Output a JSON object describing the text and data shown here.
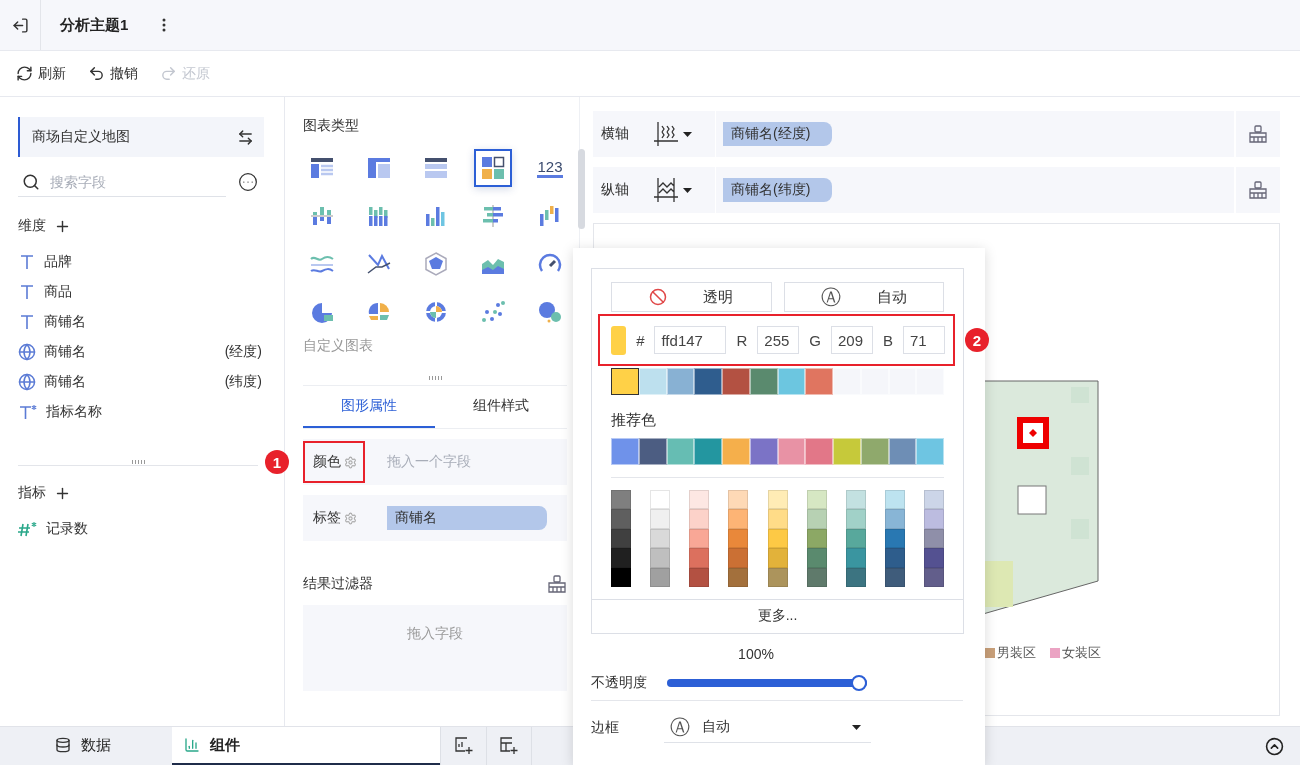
{
  "header": {
    "title": "分析主题1"
  },
  "toolbar": [
    {
      "kind": "refresh",
      "label": "刷新",
      "disabled": false
    },
    {
      "kind": "undo",
      "label": "撤销",
      "disabled": false
    },
    {
      "kind": "redo",
      "label": "还原",
      "disabled": true
    }
  ],
  "dataset": {
    "name": "商场自定义地图"
  },
  "search": {
    "placeholder": "搜索字段"
  },
  "dimensions": {
    "title": "维度",
    "fields": [
      {
        "kind": "text",
        "name": "品牌"
      },
      {
        "kind": "text",
        "name": "商品"
      },
      {
        "kind": "text",
        "name": "商铺名"
      },
      {
        "kind": "geo",
        "name": "商铺名",
        "suffix": "(经度)"
      },
      {
        "kind": "geo",
        "name": "商铺名",
        "suffix": "(纬度)"
      },
      {
        "kind": "calc-text",
        "name": "指标名称"
      }
    ]
  },
  "measures": {
    "title": "指标",
    "fields": [
      {
        "kind": "calc-number",
        "name": "记录数"
      }
    ]
  },
  "chart_types": {
    "title": "图表类型",
    "custom_label": "自定义图表",
    "items": [
      {
        "kind": "table",
        "selected": false
      },
      {
        "kind": "crosstab",
        "selected": false
      },
      {
        "kind": "detail",
        "selected": false
      },
      {
        "kind": "dashboard",
        "selected": true
      },
      {
        "kind": "kpi",
        "label": "123",
        "selected": false
      },
      {
        "kind": "bar-dot",
        "selected": false
      },
      {
        "kind": "bar-stack",
        "selected": false
      },
      {
        "kind": "bar",
        "selected": false
      },
      {
        "kind": "bar-horizontal",
        "selected": false
      },
      {
        "kind": "waterfall",
        "selected": false
      },
      {
        "kind": "line-wave",
        "selected": false
      },
      {
        "kind": "line",
        "selected": false
      },
      {
        "kind": "radar",
        "selected": false
      },
      {
        "kind": "area",
        "selected": false
      },
      {
        "kind": "gauge",
        "selected": false
      },
      {
        "kind": "pie",
        "selected": false
      },
      {
        "kind": "pie-split",
        "selected": false
      },
      {
        "kind": "sunburst",
        "selected": false
      },
      {
        "kind": "scatter",
        "selected": false
      },
      {
        "kind": "bubble",
        "selected": false
      }
    ]
  },
  "property_tabs": [
    {
      "label": "图形属性",
      "selected": true
    },
    {
      "label": "组件样式",
      "selected": false
    }
  ],
  "properties": [
    {
      "label": "颜色",
      "placeholder": "拖入一个字段",
      "highlighted": true,
      "badge": "1"
    },
    {
      "label": "标签",
      "chip": "商铺名",
      "highlighted": false
    }
  ],
  "result_filter": {
    "title": "结果过滤器",
    "placeholder": "拖入字段"
  },
  "axes": [
    {
      "kind": "x",
      "label": "横轴",
      "chip": "商铺名(经度)"
    },
    {
      "kind": "y",
      "label": "纵轴",
      "chip": "商铺名(纬度)"
    }
  ],
  "chart": {
    "legend": [
      {
        "label": "男装区",
        "color": "#c9a07a"
      },
      {
        "label": "女装区",
        "color": "#eba3c3"
      }
    ]
  },
  "color_picker": {
    "transparent_label": "透明",
    "auto_icon": "Ⓐ",
    "auto_label": "自动",
    "current": {
      "color": "#ffd147"
    },
    "hash": "#",
    "hex": "ffd147",
    "r_label": "R",
    "r": "255",
    "g_label": "G",
    "g": "209",
    "b_label": "B",
    "b": "71",
    "highlighted": true,
    "badge": "2",
    "recent": [
      {
        "color": "#ffd147",
        "selected": true
      },
      {
        "color": "#bde0ee",
        "selected": false
      },
      {
        "color": "#88b1d3",
        "selected": false
      },
      {
        "color": "#2f5d8e",
        "selected": false
      },
      {
        "color": "#b35142",
        "selected": false
      },
      {
        "color": "#5a8a6e",
        "selected": false
      },
      {
        "color": "#6cc6e0",
        "selected": false
      },
      {
        "color": "#e07560",
        "selected": false
      },
      {
        "color": "#f5f6fa",
        "selected": false
      },
      {
        "color": "#f5f6fa",
        "selected": false
      },
      {
        "color": "#f5f6fa",
        "selected": false
      },
      {
        "color": "#f5f6fa",
        "selected": false
      }
    ],
    "recommended_label": "推荐色",
    "recommended": [
      {
        "color": "#6f92ea"
      },
      {
        "color": "#4c5d82"
      },
      {
        "color": "#66bdb3"
      },
      {
        "color": "#2396a0"
      },
      {
        "color": "#f5af4b"
      },
      {
        "color": "#7b73c6"
      },
      {
        "color": "#e892a5"
      },
      {
        "color": "#e27788"
      },
      {
        "color": "#c6c93a"
      },
      {
        "color": "#8fa96c"
      },
      {
        "color": "#6e8eb5"
      },
      {
        "color": "#6ec5e2"
      }
    ],
    "shades": [
      {
        "colors": [
          {
            "color": "#7f7f7f"
          },
          {
            "color": "#5f5f5f"
          },
          {
            "color": "#404040"
          },
          {
            "color": "#202020"
          },
          {
            "color": "#000000"
          }
        ]
      },
      {
        "colors": [
          {
            "color": "#ffffff"
          },
          {
            "color": "#f0f0f0"
          },
          {
            "color": "#d9d9d9"
          },
          {
            "color": "#bfbfbf"
          },
          {
            "color": "#a0a0a0"
          }
        ]
      },
      {
        "colors": [
          {
            "color": "#fde7e3"
          },
          {
            "color": "#fcd2c9"
          },
          {
            "color": "#f9a796"
          },
          {
            "color": "#dc705e"
          },
          {
            "color": "#b35142"
          }
        ]
      },
      {
        "colors": [
          {
            "color": "#fed9b6"
          },
          {
            "color": "#fdb475"
          },
          {
            "color": "#e9883a"
          },
          {
            "color": "#cb7034"
          },
          {
            "color": "#a3703c"
          }
        ]
      },
      {
        "colors": [
          {
            "color": "#ffecb5"
          },
          {
            "color": "#ffdc88"
          },
          {
            "color": "#fdc945"
          },
          {
            "color": "#e2b23a"
          },
          {
            "color": "#ac945c"
          }
        ]
      },
      {
        "colors": [
          {
            "color": "#d6e7c3"
          },
          {
            "color": "#b7d1b3"
          },
          {
            "color": "#8ca865"
          },
          {
            "color": "#5a8a6e"
          },
          {
            "color": "#5f7a6b"
          }
        ]
      },
      {
        "colors": [
          {
            "color": "#c3e1e1"
          },
          {
            "color": "#a1d1c8"
          },
          {
            "color": "#58a89c"
          },
          {
            "color": "#3a95a0"
          },
          {
            "color": "#3c7481"
          }
        ]
      },
      {
        "colors": [
          {
            "color": "#bde3f0"
          },
          {
            "color": "#88b5d6"
          },
          {
            "color": "#2978b2"
          },
          {
            "color": "#2e5d8c"
          },
          {
            "color": "#3f5c7b"
          }
        ]
      },
      {
        "colors": [
          {
            "color": "#ccd5e8"
          },
          {
            "color": "#bcbce0"
          },
          {
            "color": "#8f8fa9"
          },
          {
            "color": "#545191"
          },
          {
            "color": "#625e8b"
          }
        ]
      }
    ],
    "more_label": "更多...",
    "opacity_reading": "100%",
    "opacity_label": "不透明度",
    "opacity": {
      "level": 1
    },
    "border_label": "边框",
    "border_icon": "Ⓐ",
    "border_value": "自动"
  },
  "bottom_tabs": [
    {
      "kind": "data",
      "label": "数据",
      "selected": false
    },
    {
      "kind": "component",
      "label": "组件",
      "selected": true
    }
  ]
}
